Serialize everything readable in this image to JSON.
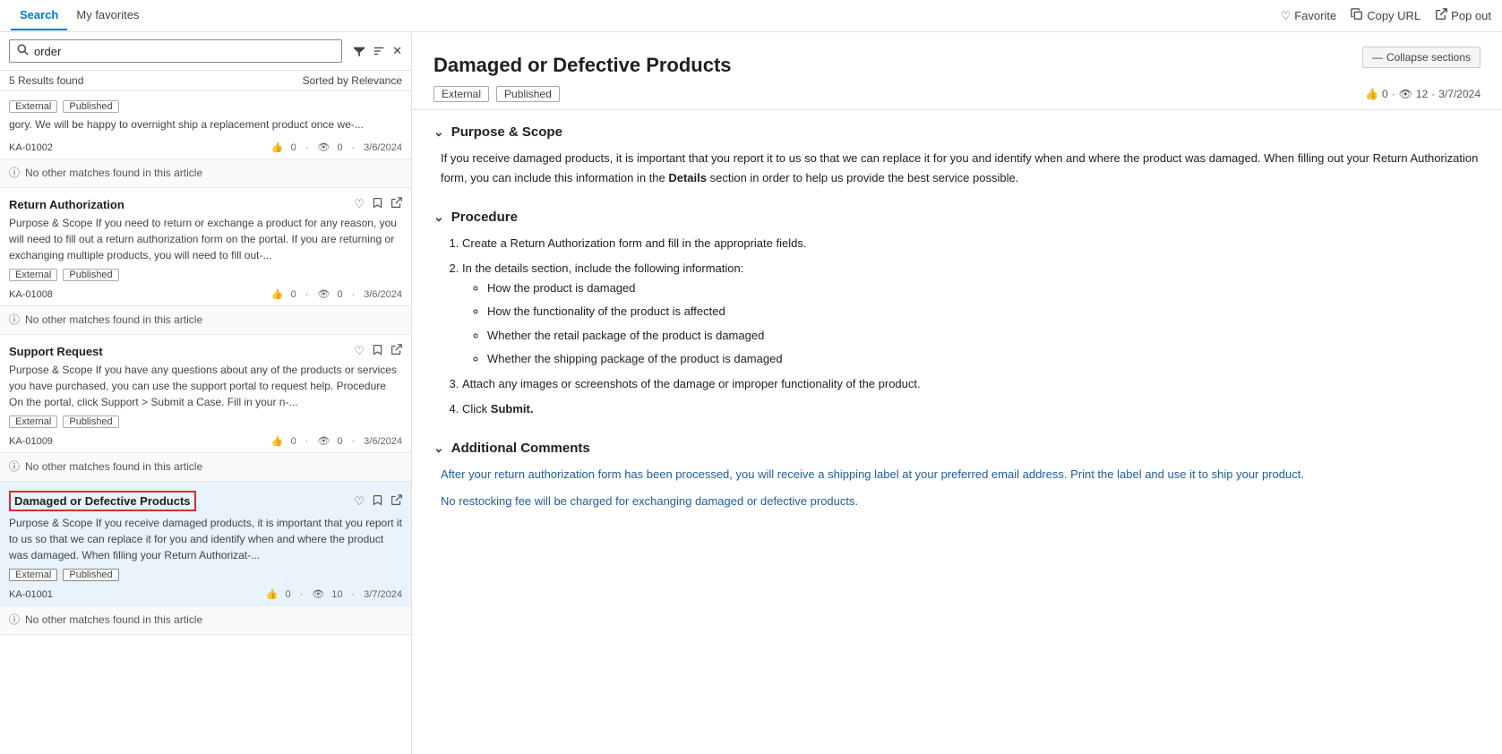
{
  "tabs": [
    {
      "id": "search",
      "label": "Search",
      "active": true
    },
    {
      "id": "favorites",
      "label": "My favorites",
      "active": false
    }
  ],
  "topbar_actions": [
    {
      "id": "favorite",
      "label": "Favorite",
      "icon": "heart-icon"
    },
    {
      "id": "copy-url",
      "label": "Copy URL",
      "icon": "copy-icon"
    },
    {
      "id": "pop-out",
      "label": "Pop out",
      "icon": "popout-icon"
    }
  ],
  "search": {
    "placeholder": "order",
    "value": "order",
    "results_count": "5 Results found",
    "sort_label": "Sorted by Relevance"
  },
  "filter_icon": "filter-icon",
  "sort_icon": "sort-icon",
  "clear_icon": "clear-icon",
  "results": [
    {
      "id": "r1",
      "title": null,
      "snippet": "gory. We will be happy to overnight ship a replacement product once we-...",
      "tags": [
        "External",
        "Published"
      ],
      "article_id": "KA-01002",
      "likes": "0",
      "views": "0",
      "date": "3/6/2024",
      "selected": false,
      "no_match": "No other matches found in this article"
    },
    {
      "id": "r2",
      "title": "Return Authorization",
      "snippet": "Purpose & Scope If you need to return or exchange a product for any reason, you will need to fill out a return authorization form on the portal. If you are returning or exchanging multiple products, you will need to fill out-...",
      "tags": [
        "External",
        "Published"
      ],
      "article_id": "KA-01008",
      "likes": "0",
      "views": "0",
      "date": "3/6/2024",
      "selected": false,
      "no_match": "No other matches found in this article"
    },
    {
      "id": "r3",
      "title": "Support Request",
      "snippet": "Purpose & Scope If you have any questions about any of the products or services you have purchased, you can use the support portal to request help. Procedure On the portal, click Support > Submit a Case. Fill in your n-...",
      "tags": [
        "External",
        "Published"
      ],
      "article_id": "KA-01009",
      "likes": "0",
      "views": "0",
      "date": "3/6/2024",
      "selected": false,
      "no_match": "No other matches found in this article"
    },
    {
      "id": "r4",
      "title": "Damaged or Defective Products",
      "snippet": "Purpose & Scope If you receive damaged products, it is important that you report it to us so that we can replace it for you and identify when and where the product was damaged. When filling your Return Authorizat-...",
      "tags": [
        "External",
        "Published"
      ],
      "article_id": "KA-01001",
      "likes": "0",
      "views": "10",
      "date": "3/7/2024",
      "selected": true,
      "no_match": "No other matches found in this article"
    }
  ],
  "article": {
    "title": "Damaged or Defective Products",
    "tags": [
      "External",
      "Published"
    ],
    "likes": "0",
    "views": "12",
    "date": "3/7/2024",
    "collapse_btn": "Collapse sections",
    "sections": [
      {
        "id": "purpose",
        "heading": "Purpose & Scope",
        "expanded": true,
        "content_type": "paragraph",
        "paragraphs": [
          "If you receive damaged products, it is important that you report it to us so that we can replace it for you and identify when and where the product was damaged. When filling out your Return Authorization form, you can include this information in the Details section in order to help us provide the best service possible."
        ],
        "bold_words": [
          "Details"
        ]
      },
      {
        "id": "procedure",
        "heading": "Procedure",
        "expanded": true,
        "content_type": "ordered-list",
        "steps": [
          {
            "text": "Create a Return Authorization form and fill in the appropriate fields.",
            "sub_items": []
          },
          {
            "text": "In the details section, include the following information:",
            "sub_items": [
              "How the product is damaged",
              "How the functionality of the product is affected",
              "Whether the retail package of the product is damaged",
              "Whether the shipping package of the product is damaged"
            ]
          },
          {
            "text": "Attach any images or screenshots of the damage or improper functionality of the product.",
            "sub_items": []
          },
          {
            "text": "Click Submit.",
            "sub_items": [],
            "bold": "Submit"
          }
        ]
      },
      {
        "id": "additional",
        "heading": "Additional Comments",
        "expanded": true,
        "content_type": "paragraph",
        "paragraphs": [
          "After your return authorization form has been processed, you will receive a shipping label at your preferred email address. Print the label and use it to ship your product.",
          "No restocking fee will be charged for exchanging damaged or defective products."
        ],
        "blue_paragraphs": [
          0,
          1
        ]
      }
    ]
  }
}
